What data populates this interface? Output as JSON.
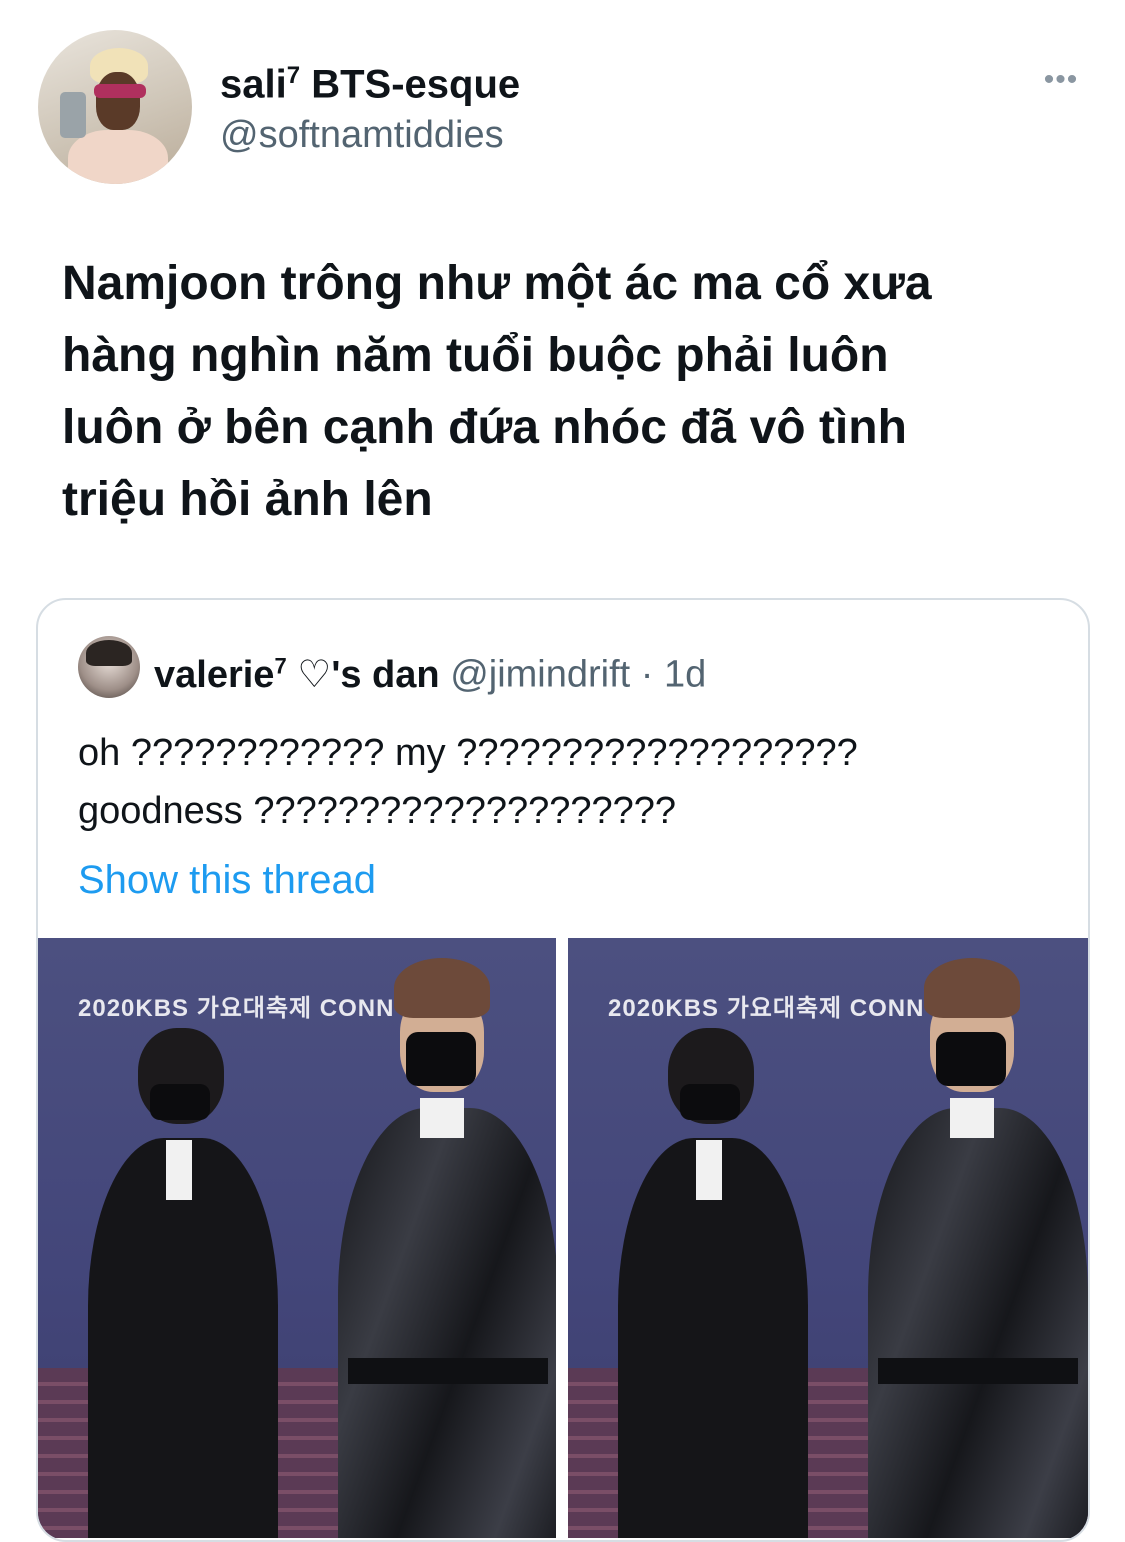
{
  "tweet": {
    "display_name": "sali",
    "display_name_sup": "7",
    "display_name_suffix": " BTS-esque",
    "handle": "@softnamtiddies",
    "more_icon": "•••",
    "text": "Namjoon trông như một ác ma cổ xưa\nhàng nghìn năm tuổi buộc phải luôn\nluôn ở bên cạnh đứa nhóc đã vô tình\ntriệu hồi ảnh lên"
  },
  "quote": {
    "display_name": "valerie",
    "display_name_sup": "7",
    "display_name_suffix": " ♡'s dan",
    "handle": "@jimindrift",
    "separator": " · ",
    "time": "1d",
    "text": "oh ???????????? my ???????????????????\ngoodness ????????????????????",
    "show_thread": "Show this thread",
    "photo_logo": "2020KBS 가요대축제 CONN"
  }
}
